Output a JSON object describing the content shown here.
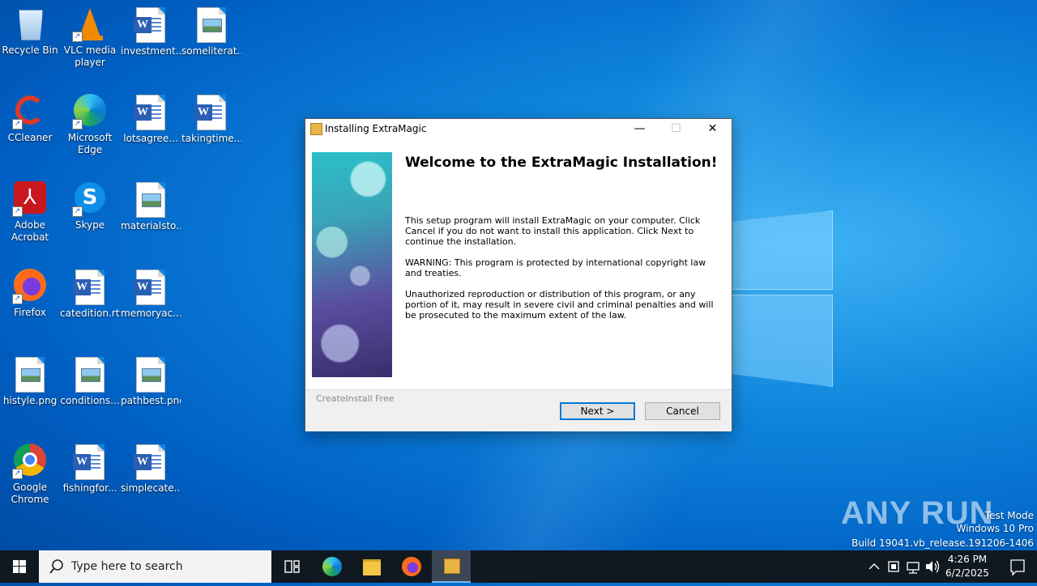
{
  "desktop": {
    "icons": [
      {
        "label": "Recycle Bin"
      },
      {
        "label": "VLC media player"
      },
      {
        "label": "investment..."
      },
      {
        "label": "someliterat..."
      },
      {
        "label": "CCleaner"
      },
      {
        "label": "Microsoft Edge"
      },
      {
        "label": "lotsagree..."
      },
      {
        "label": "takingtime..."
      },
      {
        "label": "Adobe Acrobat"
      },
      {
        "label": "Skype"
      },
      {
        "label": "materialsto..."
      },
      {
        "label": "Firefox"
      },
      {
        "label": "catedition.rtf"
      },
      {
        "label": "memoryac..."
      },
      {
        "label": "histyle.png"
      },
      {
        "label": "conditions..."
      },
      {
        "label": "pathbest.png"
      },
      {
        "label": "Google Chrome"
      },
      {
        "label": "fishingfor..."
      },
      {
        "label": "simplecate..."
      }
    ]
  },
  "installer": {
    "title": "Installing ExtraMagic",
    "heading": "Welcome to the ExtraMagic Installation!",
    "paragraph1": "This setup program will install ExtraMagic on your computer. Click Cancel if you do not want to install this application. Click Next to continue the installation.",
    "paragraph2": "WARNING: This program is protected by international copyright law and treaties.",
    "paragraph3": "Unauthorized reproduction or distribution of this program, or any portion of it, may result in severe civil and criminal penalties and will be prosecuted to the maximum extent of the law.",
    "brand": "CreateInstall Free",
    "next_label": "Next >",
    "cancel_label": "Cancel",
    "minimize_glyph": "—",
    "maximize_glyph": "☐",
    "close_glyph": "✕"
  },
  "taskbar": {
    "search_placeholder": "Type here to search",
    "time": "4:26 PM",
    "date": "6/2/2025"
  },
  "watermark": {
    "line1": "Test Mode",
    "line2": "Windows 10 Pro",
    "line3": "Build 19041.vb_release.191206-1406",
    "brand": "ANY RUN"
  }
}
